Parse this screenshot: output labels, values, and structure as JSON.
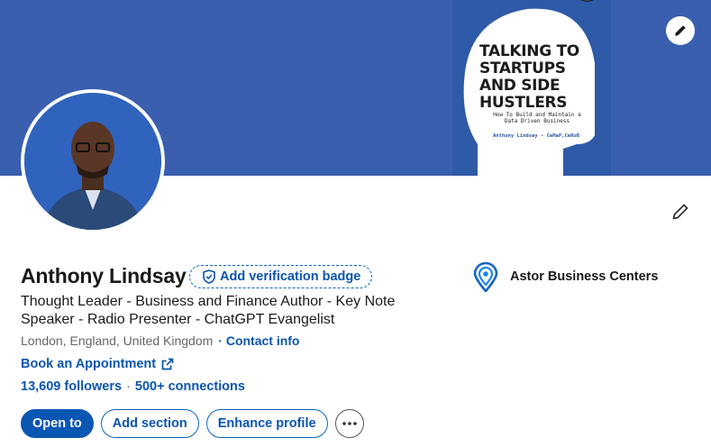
{
  "banner": {
    "cover_title": "TALKING TO STARTUPS AND SIDE HUSTLERS",
    "cover_subtitle": "How To Build and Maintain a Data Driven Business",
    "cover_author": "Anthony Lindsay - CeMaP,CeRoB",
    "edit_icon": "pencil-icon"
  },
  "profile": {
    "name": "Anthony Lindsay",
    "verification_label": "Add verification badge",
    "headline": "Thought Leader -  Business and Finance Author - Key Note Speaker -  Radio Presenter - ChatGPT Evangelist",
    "location": "London, England, United Kingdom",
    "contact_label": "· Contact info",
    "appointment_label": "Book an Appointment",
    "followers": "13,609 followers",
    "separator": "·",
    "connections": "500+ connections"
  },
  "company": {
    "name": "Astor Business Centers",
    "brand_color": "#1565c0"
  },
  "actions": {
    "open_to": "Open to",
    "add_section": "Add section",
    "enhance_profile": "Enhance profile",
    "more_icon": "ellipsis-icon"
  },
  "colors": {
    "banner": "#3a5fae",
    "link": "#0a55b0",
    "primary_button": "#0a56b3"
  }
}
